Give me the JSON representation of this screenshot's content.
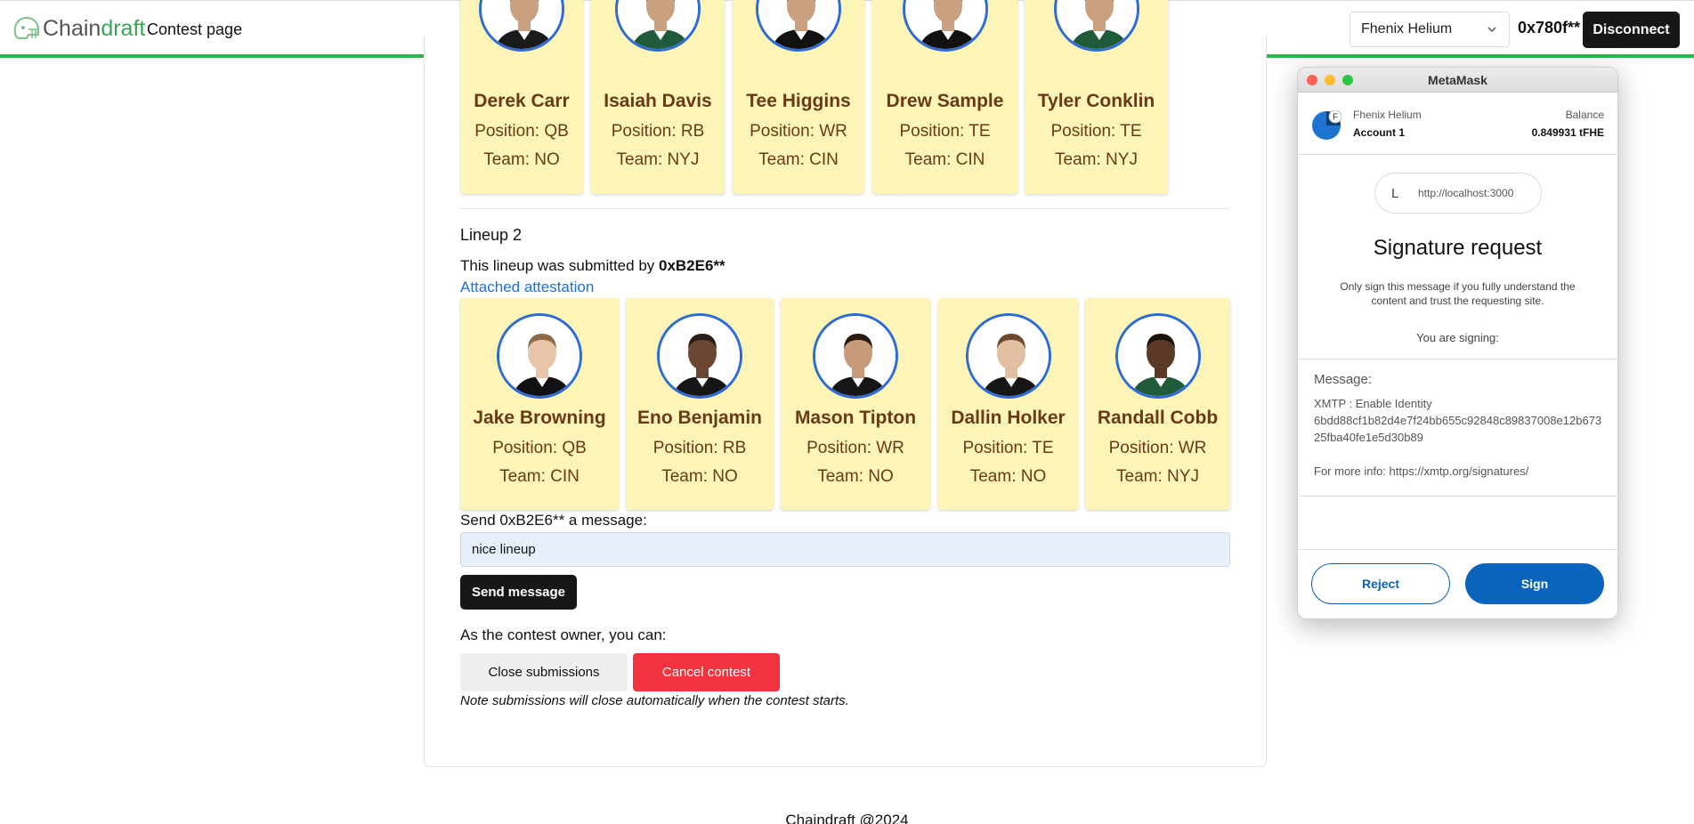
{
  "header": {
    "logo_part1": "Chain",
    "logo_part2": "draft",
    "page_title": "Contest page",
    "network_select": "Fhenix Helium",
    "address": "0x780f**",
    "disconnect_label": "Disconnect",
    "brand_color": "#2fb44b"
  },
  "lineup1": {
    "players": [
      {
        "name": "Derek Carr",
        "position": "Position: QB",
        "team": "Team: NO",
        "jersey": "#1a1a1a"
      },
      {
        "name": "Isaiah Davis",
        "position": "Position: RB",
        "team": "Team: NYJ",
        "jersey": "#1f5a3a"
      },
      {
        "name": "Tee Higgins",
        "position": "Position: WR",
        "team": "Team: CIN",
        "jersey": "#111111"
      },
      {
        "name": "Drew Sample",
        "position": "Position: TE",
        "team": "Team: CIN",
        "jersey": "#111111"
      },
      {
        "name": "Tyler Conklin",
        "position": "Position: TE",
        "team": "Team: NYJ",
        "jersey": "#1f5a3a"
      }
    ]
  },
  "lineup2": {
    "title": "Lineup 2",
    "submitted_prefix": "This lineup was submitted by ",
    "submitted_by": "0xB2E6**",
    "attestation_link": "Attached attestation",
    "players": [
      {
        "name": "Jake Browning",
        "position": "Position: QB",
        "team": "Team: CIN",
        "jersey": "#111111",
        "skin": "#e8c4a8",
        "hair": "#8a6a48"
      },
      {
        "name": "Eno Benjamin",
        "position": "Position: RB",
        "team": "Team: NO",
        "jersey": "#161616",
        "skin": "#6b4630",
        "hair": "#2a1c14"
      },
      {
        "name": "Mason Tipton",
        "position": "Position: WR",
        "team": "Team: NO",
        "jersey": "#161616",
        "skin": "#c79a7a",
        "hair": "#2b1a12"
      },
      {
        "name": "Dallin Holker",
        "position": "Position: TE",
        "team": "Team: NO",
        "jersey": "#161616",
        "skin": "#e3bfa2",
        "hair": "#6b4a30"
      },
      {
        "name": "Randall Cobb",
        "position": "Position: WR",
        "team": "Team: NYJ",
        "jersey": "#1f5a3a",
        "skin": "#5a3a26",
        "hair": "#1c120c"
      }
    ]
  },
  "message": {
    "label": "Send 0xB2E6** a message:",
    "value": "nice lineup",
    "send_label": "Send message"
  },
  "owner": {
    "label": "As the contest owner, you can:",
    "close_label": "Close submissions",
    "cancel_label": "Cancel contest",
    "note": "Note submissions will close automatically when the contest starts."
  },
  "footer": {
    "text": "Chaindraft @2024"
  },
  "metamask": {
    "window_title": "MetaMask",
    "network": "Fhenix Helium",
    "account": "Account 1",
    "balance_label": "Balance",
    "balance": "0.849931 tFHE",
    "origin_initial": "L",
    "origin_url": "http://localhost:3000",
    "heading": "Signature request",
    "subtext": "Only sign this message if you fully understand the content and trust the requesting site.",
    "signing_label": "You are signing:",
    "message_label": "Message:",
    "message_body": "XMTP : Enable Identity\n6bdd88cf1b82d4e7f24bb655c92848c89837008e12b67325fba40fe1e5d30b89\n\nFor more info: https://xmtp.org/signatures/",
    "reject_label": "Reject",
    "sign_label": "Sign"
  }
}
